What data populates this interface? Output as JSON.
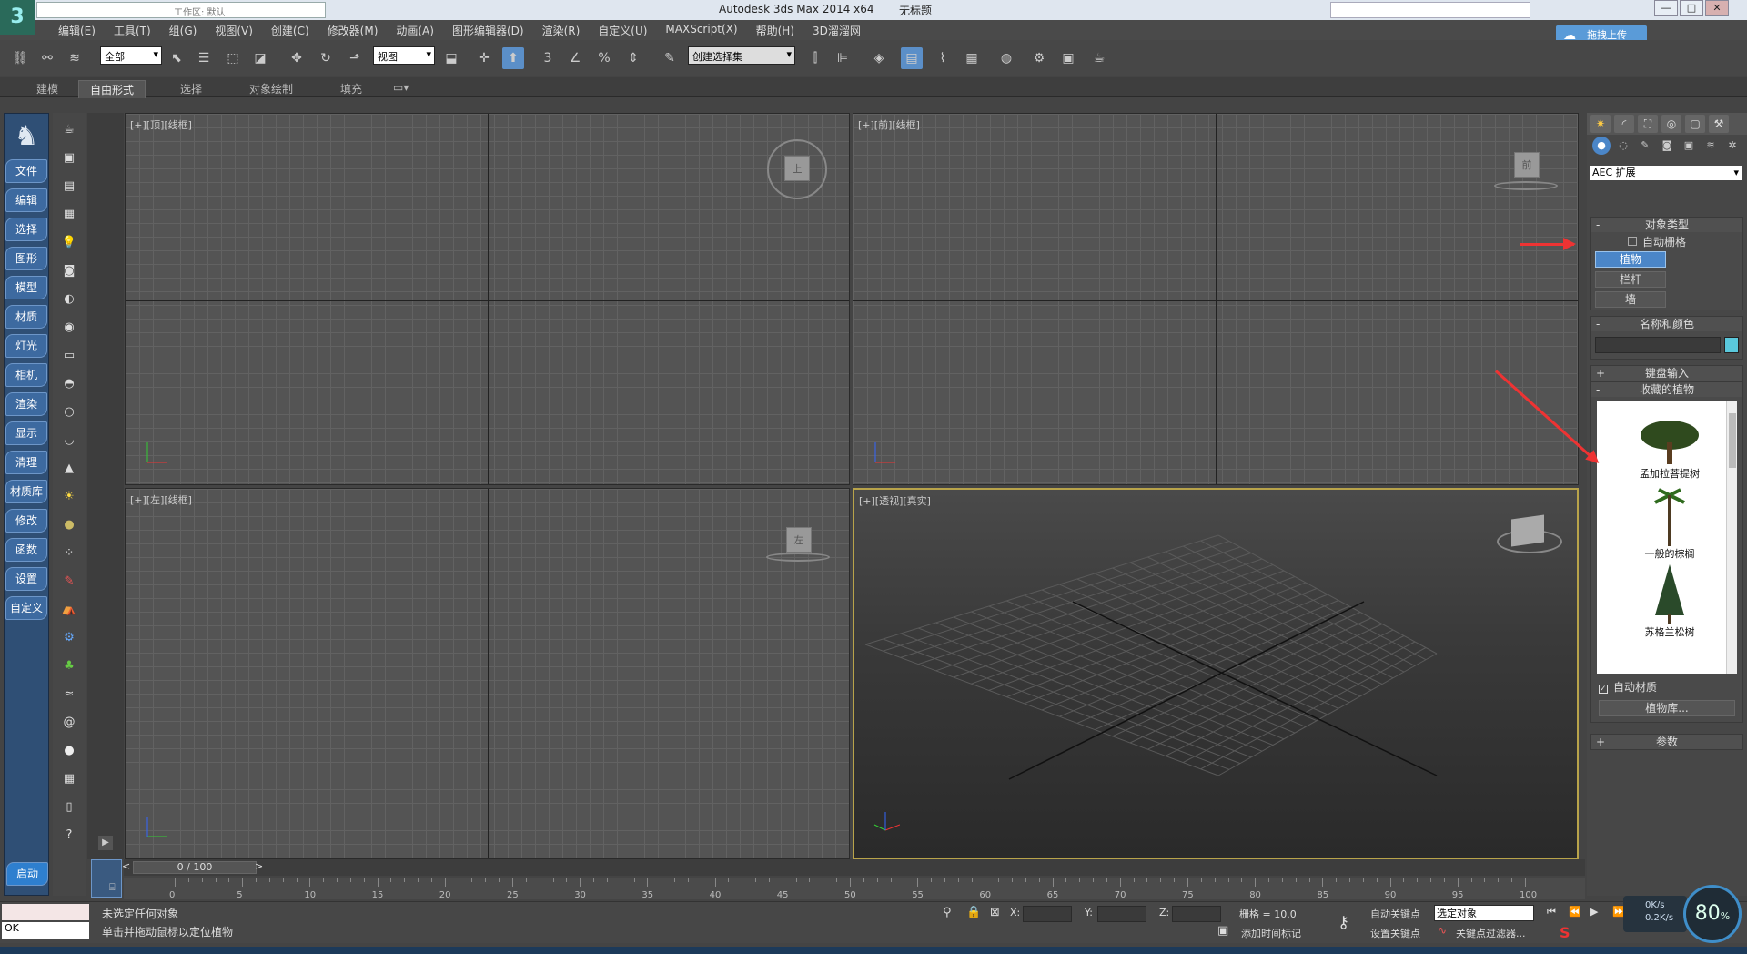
{
  "title_bar": {
    "app_title": "Autodesk 3ds Max  2014 x64",
    "doc_title": "无标题",
    "workspace": "工作区: 默认",
    "controls": [
      "—",
      "□",
      "✕"
    ]
  },
  "menu": [
    "编辑(E)",
    "工具(T)",
    "组(G)",
    "视图(V)",
    "创建(C)",
    "修改器(M)",
    "动画(A)",
    "图形编辑器(D)",
    "渲染(R)",
    "自定义(U)",
    "MAXScript(X)",
    "帮助(H)",
    "3D溜溜网"
  ],
  "upload_button": "拖拽上传",
  "toolbar": {
    "filter_select": "全部",
    "ref_coord_select": "视图",
    "snap_label": "3",
    "selection_set": "创建选择集"
  },
  "ribbon_tabs": [
    "建模",
    "自由形式",
    "选择",
    "对象绘制",
    "填充"
  ],
  "left_sidebar": {
    "buttons": [
      "文件",
      "编辑",
      "选择",
      "图形",
      "模型",
      "材质",
      "灯光",
      "相机",
      "渲染",
      "显示",
      "清理",
      "材质库",
      "修改",
      "函数",
      "设置",
      "自定义"
    ],
    "start": "启动"
  },
  "viewports": {
    "top": {
      "label": "[+][顶][线框]",
      "cube": "上"
    },
    "front": {
      "label": "[+][前][线框]",
      "cube": "前"
    },
    "left": {
      "label": "[+][左][线框]",
      "cube": "左"
    },
    "perspective": {
      "label": "[+][透视][真实]"
    }
  },
  "command_panel": {
    "category_select": "AEC 扩展",
    "rollout_object_type": "对象类型",
    "auto_grid": "自动栅格",
    "btn_foliage": "植物",
    "btn_railing": "栏杆",
    "btn_wall": "墙",
    "rollout_name_color": "名称和颜色",
    "name_color_hex": "#5ac8dc",
    "rollout_keyboard": "键盘输入",
    "rollout_favorites": "收藏的植物",
    "plants": [
      "孟加拉菩提树",
      "一般的棕榈",
      "苏格兰松树"
    ],
    "auto_material": "自动材质",
    "plant_library": "植物库...",
    "rollout_params": "参数"
  },
  "timeline": {
    "frame": "0 / 100",
    "ticks": [
      "0",
      "5",
      "10",
      "15",
      "20",
      "25",
      "30",
      "35",
      "40",
      "45",
      "50",
      "55",
      "60",
      "65",
      "70",
      "75",
      "80",
      "85",
      "90",
      "95",
      "100"
    ]
  },
  "status": {
    "selection": "未选定任何对象",
    "prompt": "单击并拖动鼠标以定位植物",
    "x_label": "X:",
    "y_label": "Y:",
    "z_label": "Z:",
    "grid": "栅格 = 10.0",
    "auto_key": "自动关键点",
    "selected_object": "选定对象",
    "set_key": "设置关键点",
    "key_filter": "关键点过滤器...",
    "add_time_tag": "添加时间标记",
    "listener_ok": "OK"
  },
  "speed_widget": {
    "percent": "80",
    "unit": "%",
    "up": "0K/s",
    "down": "0.2K/s"
  }
}
